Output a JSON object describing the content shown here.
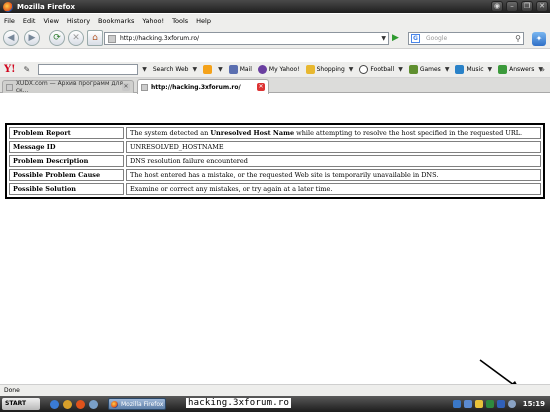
{
  "window": {
    "title": "Mozilla Firefox",
    "controls": [
      "◉",
      "–",
      "❐",
      "✕"
    ]
  },
  "menu": [
    "File",
    "Edit",
    "View",
    "History",
    "Bookmarks",
    "Yahoo!",
    "Tools",
    "Help"
  ],
  "nav": {
    "url": "http://hacking.3xforum.ro/",
    "search_placeholder": "Google",
    "back": "◀",
    "forward": "▶",
    "reload": "⟳",
    "stop": "✕",
    "home": "⌂",
    "go": "▶",
    "search_icon": "⚲",
    "addon": "✦"
  },
  "yahoo_toolbar": {
    "logo": "Y!",
    "items": [
      {
        "label": "Search Web",
        "icon": "search-web-icon",
        "color": "#ffffff"
      },
      {
        "label": "",
        "icon": "plus-icon",
        "color": "#f4a21a"
      },
      {
        "label": "Mail",
        "icon": "mail-icon",
        "color": "#5b6fb0"
      },
      {
        "label": "My Yahoo!",
        "icon": "my-yahoo-icon",
        "color": "#6a3fa0"
      },
      {
        "label": "Shopping",
        "icon": "shopping-icon",
        "color": "#e8b830"
      },
      {
        "label": "Football",
        "icon": "football-icon",
        "color": "#444444"
      },
      {
        "label": "Games",
        "icon": "games-icon",
        "color": "#5f8f2f"
      },
      {
        "label": "Music",
        "icon": "music-icon",
        "color": "#2a82c8"
      },
      {
        "label": "Answers",
        "icon": "answers-icon",
        "color": "#3b9a3b"
      }
    ],
    "more": "»"
  },
  "tabs": [
    {
      "label": "XUDX.com — Архив программ для ск...",
      "active": false
    },
    {
      "label": "http://hacking.3xforum.ro/",
      "active": true
    }
  ],
  "error_table": {
    "rows": [
      {
        "label": "Problem Report",
        "value_pre": "The system detected an ",
        "value_bold": "Unresolved Host Name",
        "value_post": " while attempting to resolve the host specified in the requested URL."
      },
      {
        "label": "Message ID",
        "value_pre": "UNRESOLVED_HOSTNAME",
        "value_bold": "",
        "value_post": ""
      },
      {
        "label": "Problem Description",
        "value_pre": "DNS resolution failure encountered",
        "value_bold": "",
        "value_post": ""
      },
      {
        "label": "Possible Problem Cause",
        "value_pre": "The host entered has a mistake, or the requested Web site is temporarily unavailable in DNS.",
        "value_bold": "",
        "value_post": ""
      },
      {
        "label": "Possible Solution",
        "value_pre": "Examine or correct any mistakes, or try again at a later time.",
        "value_bold": "",
        "value_post": ""
      }
    ]
  },
  "status": {
    "text": "Done"
  },
  "taskbar": {
    "start": "START",
    "task": "Mozilla Firefox",
    "clock": "15:19"
  },
  "overlay": {
    "text": "hacking.3xforum.ro"
  }
}
